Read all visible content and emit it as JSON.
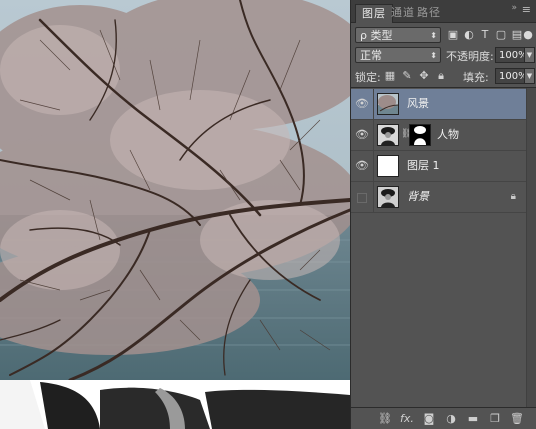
{
  "panel": {
    "tabs": [
      {
        "label": "图层",
        "active": true
      },
      {
        "label": "通道",
        "active": false
      },
      {
        "label": "路径",
        "active": false
      }
    ],
    "collapse_icon": "double-chevron-right-icon",
    "menu_icon": "panel-menu-icon"
  },
  "filter": {
    "kind_label": "ρ 类型",
    "icons": [
      "image-filter-icon",
      "adjustment-filter-icon",
      "type-filter-icon",
      "shape-filter-icon",
      "smart-object-filter-icon"
    ]
  },
  "blend": {
    "mode": "正常",
    "opacity_label": "不透明度:",
    "opacity_value": "100%"
  },
  "lock": {
    "label": "锁定:",
    "icons": [
      "lock-transparent-icon",
      "lock-image-icon",
      "lock-position-icon",
      "lock-all-icon"
    ],
    "fill_label": "填充:",
    "fill_value": "100%"
  },
  "layers": [
    {
      "name": "风景",
      "visible": true,
      "selected": true,
      "thumbnail": "landscape-thumbnail"
    },
    {
      "name": "人物",
      "visible": true,
      "selected": false,
      "thumbnail": "portrait-thumbnail",
      "has_mask": true
    },
    {
      "name": "图层 1",
      "visible": true,
      "selected": false,
      "thumbnail": "white-thumbnail"
    },
    {
      "name": "背景",
      "visible": false,
      "selected": false,
      "thumbnail": "portrait-thumbnail",
      "locked": true
    }
  ],
  "bottom_icons": [
    "link-layers-icon",
    "fx-icon",
    "add-mask-icon",
    "adjustment-layer-icon",
    "new-group-icon",
    "new-layer-icon",
    "delete-icon"
  ],
  "bottom_fx": "fx.",
  "colors": {
    "panel_bg": "#535353",
    "selected_layer": "#6f7f98",
    "tab_bar": "#3d3d3d"
  }
}
